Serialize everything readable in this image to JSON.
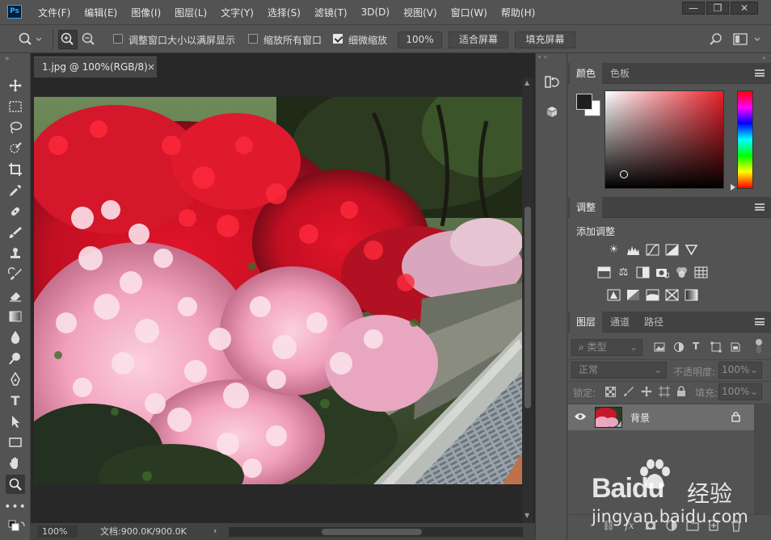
{
  "app": {
    "logo": "Ps"
  },
  "menu": {
    "items": [
      "文件(F)",
      "编辑(E)",
      "图像(I)",
      "图层(L)",
      "文字(Y)",
      "选择(S)",
      "滤镜(T)",
      "3D(D)",
      "视图(V)",
      "窗口(W)",
      "帮助(H)"
    ]
  },
  "window_controls": {
    "minimize": "—",
    "restore": "❐",
    "close": "✕"
  },
  "options": {
    "resize_windows_label": "调整窗口大小以满屏显示",
    "resize_windows_checked": false,
    "zoom_all_label": "缩放所有窗口",
    "zoom_all_checked": false,
    "scrubby_zoom_label": "细微缩放",
    "scrubby_zoom_checked": true,
    "zoom_value": "100%",
    "fit_screen_label": "适合屏幕",
    "fill_screen_label": "填充屏幕"
  },
  "document": {
    "tab_title": "1.jpg @ 100%(RGB/8)",
    "tab_close": "×",
    "status_zoom": "100%",
    "status_doc": "文档:900.0K/900.0K",
    "status_arrow": "›"
  },
  "panels": {
    "color": {
      "tabs": [
        "颜色",
        "色板"
      ],
      "foreground": "#1f1f1f",
      "background": "#ffffff",
      "field_hue": "#e8202a"
    },
    "adjustments": {
      "tab": "调整",
      "add_label": "添加调整"
    },
    "layers": {
      "tabs": [
        "图层",
        "通道",
        "路径"
      ],
      "filter_kind": "类型",
      "blend_mode": "正常",
      "opacity_label": "不透明度:",
      "opacity_value": "100%",
      "lock_label": "锁定:",
      "fill_label": "填充:",
      "fill_value": "100%",
      "layer_name": "背景"
    }
  },
  "watermark": {
    "brand": "Baidu",
    "brand_suffix": "经验",
    "url": "jingyan.baidu.com"
  },
  "colors": {
    "ui_bg": "#535353",
    "panel_header": "#424242",
    "canvas_bg": "#282828",
    "accent": "#31a8ff"
  }
}
